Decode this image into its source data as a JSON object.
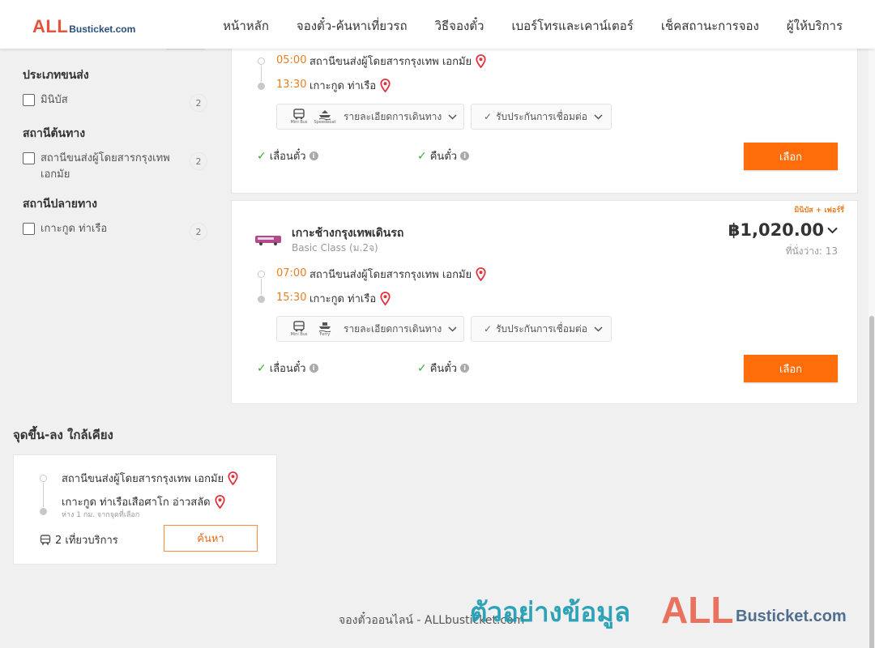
{
  "header": {
    "logo_all": "ALL",
    "logo_domain": "Busticket.com",
    "nav": [
      "หน้าหลัก",
      "จองตั๋ว-ค้นหาเที่ยวรถ",
      "วิธีจองตั๋ว",
      "เบอร์โทรและเคาน์เตอร์",
      "เช็คสถานะการจอง",
      "ผู้ให้บริการ"
    ]
  },
  "filters": {
    "vehicle_type": {
      "title": "ประเภทขนส่ง",
      "items": [
        {
          "label": "มินิบัส",
          "count": "2"
        }
      ]
    },
    "origin": {
      "title": "สถานีต้นทาง",
      "items": [
        {
          "label": "สถานีขนส่งผู้โดยสารกรุงเทพ เอกมัย",
          "count": "2"
        }
      ]
    },
    "destination": {
      "title": "สถานีปลายทาง",
      "items": [
        {
          "label": "เกาะกูด ท่าเรือ",
          "count": "2"
        }
      ]
    }
  },
  "results": [
    {
      "depart_time": "05:00",
      "depart_place": "สถานีขนส่งผู้โดยสารกรุงเทพ เอกมัย",
      "arrive_time": "13:30",
      "arrive_place": "เกาะกูด ท่าเรือ",
      "vehicle1_small": "Mini Bus",
      "vehicle2_small": "Speedboat",
      "trip_details": "รายละเอียดการเดินทาง",
      "guarantee": "รับประกันการเชื่อมต่อ",
      "reschedule": "เลื่อนตั๋ว",
      "refund": "คืนตั๋ว",
      "select": "เลือก"
    },
    {
      "promo": "มินิบัส + เฟอร์รี่",
      "operator": "เกาะช้างกรุงเทพเดินรถ",
      "class": "Basic Class (ม.2จ)",
      "price": "฿1,020.00",
      "seats": "ที่นั่งว่าง: 13",
      "depart_time": "07:00",
      "depart_place": "สถานีขนส่งผู้โดยสารกรุงเทพ เอกมัย",
      "arrive_time": "15:30",
      "arrive_place": "เกาะกูด ท่าเรือ",
      "vehicle1_small": "Mini Bus",
      "vehicle2_small": "Ferry",
      "trip_details": "รายละเอียดการเดินทาง",
      "guarantee": "รับประกันการเชื่อมต่อ",
      "reschedule": "เลื่อนตั๋ว",
      "refund": "คืนตั๋ว",
      "select": "เลือก"
    }
  ],
  "nearby": {
    "title": "จุดขึ้น-ลง ใกล้เคียง",
    "from": "สถานีขนส่งผู้โดยสารกรุงเทพ เอกมัย",
    "to": "เกาะกูด ท่าเรือเสือศาโก อ่าวสลัด",
    "distance": "ห่าง 1 กม. จากจุดที่เลือก",
    "trips": "2 เที่ยวบริการ",
    "search": "ค้นหา"
  },
  "footer": {
    "text": "จองตั๋วออนไลน์ - ALLbusticket.com",
    "watermark_thai": "ตัวอย่างข้อมูล",
    "watermark_all": "ALL",
    "watermark_domain": "Busticket.com"
  },
  "colors": {
    "accent": "#ff6d0b",
    "time": "#e67e22",
    "check": "#3aa935",
    "pin": "#e0343c"
  }
}
